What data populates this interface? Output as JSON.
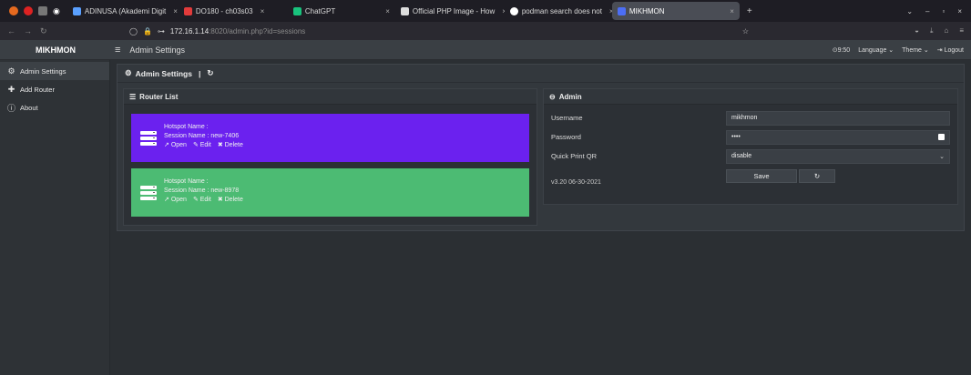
{
  "browser": {
    "tabs": [
      {
        "label": "ADINUSA (Akademi Digit",
        "color": "#5aa0ff"
      },
      {
        "label": "DO180 - ch03s03",
        "color": "#e23b3b"
      },
      {
        "label": "ChatGPT",
        "color": "#19c37d"
      },
      {
        "label": "Official PHP Image - How",
        "color": "#dddddd"
      },
      {
        "label": "podman search does not",
        "color": "#ffffff"
      },
      {
        "label": "MIKHMON",
        "color": "#4c6ef5"
      }
    ],
    "url_host": "172.16.1.14",
    "url_path": ":8020/admin.php?id=sessions"
  },
  "header": {
    "brand": "MIKHMON",
    "title": "Admin Settings",
    "time": "9:50",
    "language": "Language",
    "theme": "Theme",
    "logout": "Logout"
  },
  "sidebar": {
    "items": [
      {
        "label": "Admin Settings",
        "icon": "gear-icon"
      },
      {
        "label": "Add Router",
        "icon": "plus-icon"
      },
      {
        "label": "About",
        "icon": "info-icon"
      }
    ]
  },
  "main": {
    "title": "Admin Settings",
    "separator": "|"
  },
  "router_list": {
    "title": "Router List",
    "routers": [
      {
        "hotspot": "Hotspot Name :",
        "session": "Session Name : new-7406",
        "color": "#6b21ef"
      },
      {
        "hotspot": "Hotspot Name :",
        "session": "Session Name : new-8978",
        "color": "#4cbb73"
      }
    ],
    "actions": {
      "open": "Open",
      "edit": "Edit",
      "delete": "Delete"
    }
  },
  "admin": {
    "title": "Admin",
    "username_label": "Username",
    "username_value": "mikhmon",
    "password_label": "Password",
    "password_value": "••••",
    "qr_label": "Quick Print QR",
    "qr_value": "disable",
    "save_label": "Save",
    "version": "v3.20 06-30-2021"
  }
}
